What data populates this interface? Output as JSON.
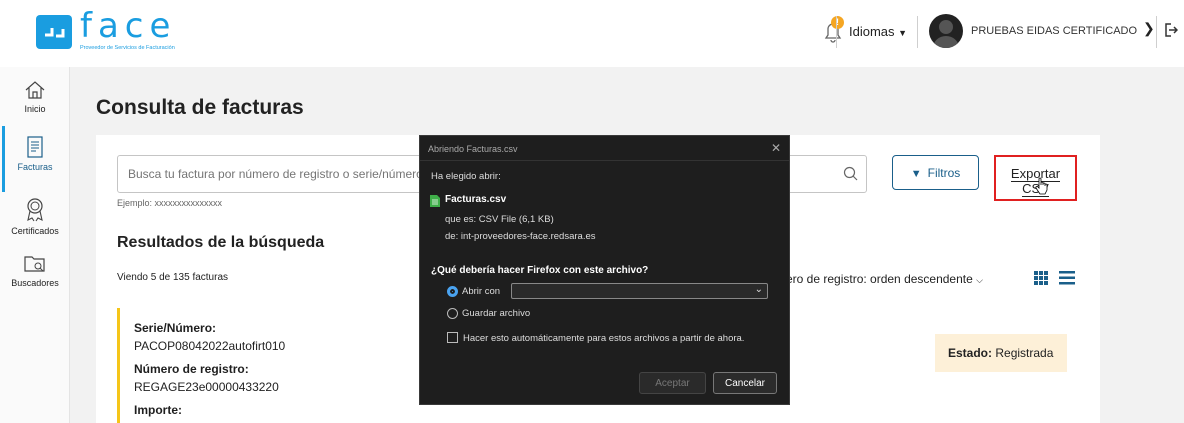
{
  "header": {
    "logo_text": "face",
    "logo_subtitle": "Proveedor de Servicios de Facturación",
    "notification_badge": "!",
    "languages_label": "Idiomas",
    "user_name": "PRUEBAS EIDAS CERTIFICADO"
  },
  "sidebar": {
    "items": [
      {
        "label": "Inicio",
        "icon": "home-icon"
      },
      {
        "label": "Facturas",
        "icon": "invoice-icon"
      },
      {
        "label": "Certificados",
        "icon": "certificate-icon"
      },
      {
        "label": "Buscadores",
        "icon": "folder-search-icon"
      }
    ],
    "active": "Facturas"
  },
  "main": {
    "title": "Consulta de facturas",
    "search_placeholder": "Busca tu factura por número de registro o serie/número",
    "search_hint": "Ejemplo: xxxxxxxxxxxxxxx",
    "filters_label": "Filtros",
    "export_label": "Exportar CSV",
    "results_title": "Resultados de la búsqueda",
    "viewing_text": "Viendo 5 de 135 facturas",
    "sort_label": "ero de registro: orden descendente",
    "invoice": {
      "serie_label": "Serie/Número:",
      "serie_value": "PACOP08042022autofirt010",
      "registro_label": "Número de registro:",
      "registro_value": "REGAGE23e00000433220",
      "importe_label": "Importe:",
      "estado_label": "Estado:",
      "estado_value": "Registrada"
    }
  },
  "dialog": {
    "title": "Abriendo Facturas.csv",
    "chosen_text": "Ha elegido abrir:",
    "file_name": "Facturas.csv",
    "file_type": "que es: CSV File (6,1 KB)",
    "file_from": "de: int-proveedores-face.redsara.es",
    "question": "¿Qué debería hacer Firefox con este archivo?",
    "open_with_label": "Abrir con",
    "save_label": "Guardar archivo",
    "auto_label": "Hacer esto automáticamente para estos archivos a partir de ahora.",
    "accept_label": "Aceptar",
    "cancel_label": "Cancelar"
  },
  "colors": {
    "brand": "#1a9de0",
    "accent_dark": "#1a5f8a",
    "highlight_red": "#e02020",
    "status_bg": "#fdf0d8",
    "invoice_border": "#f5c518"
  }
}
